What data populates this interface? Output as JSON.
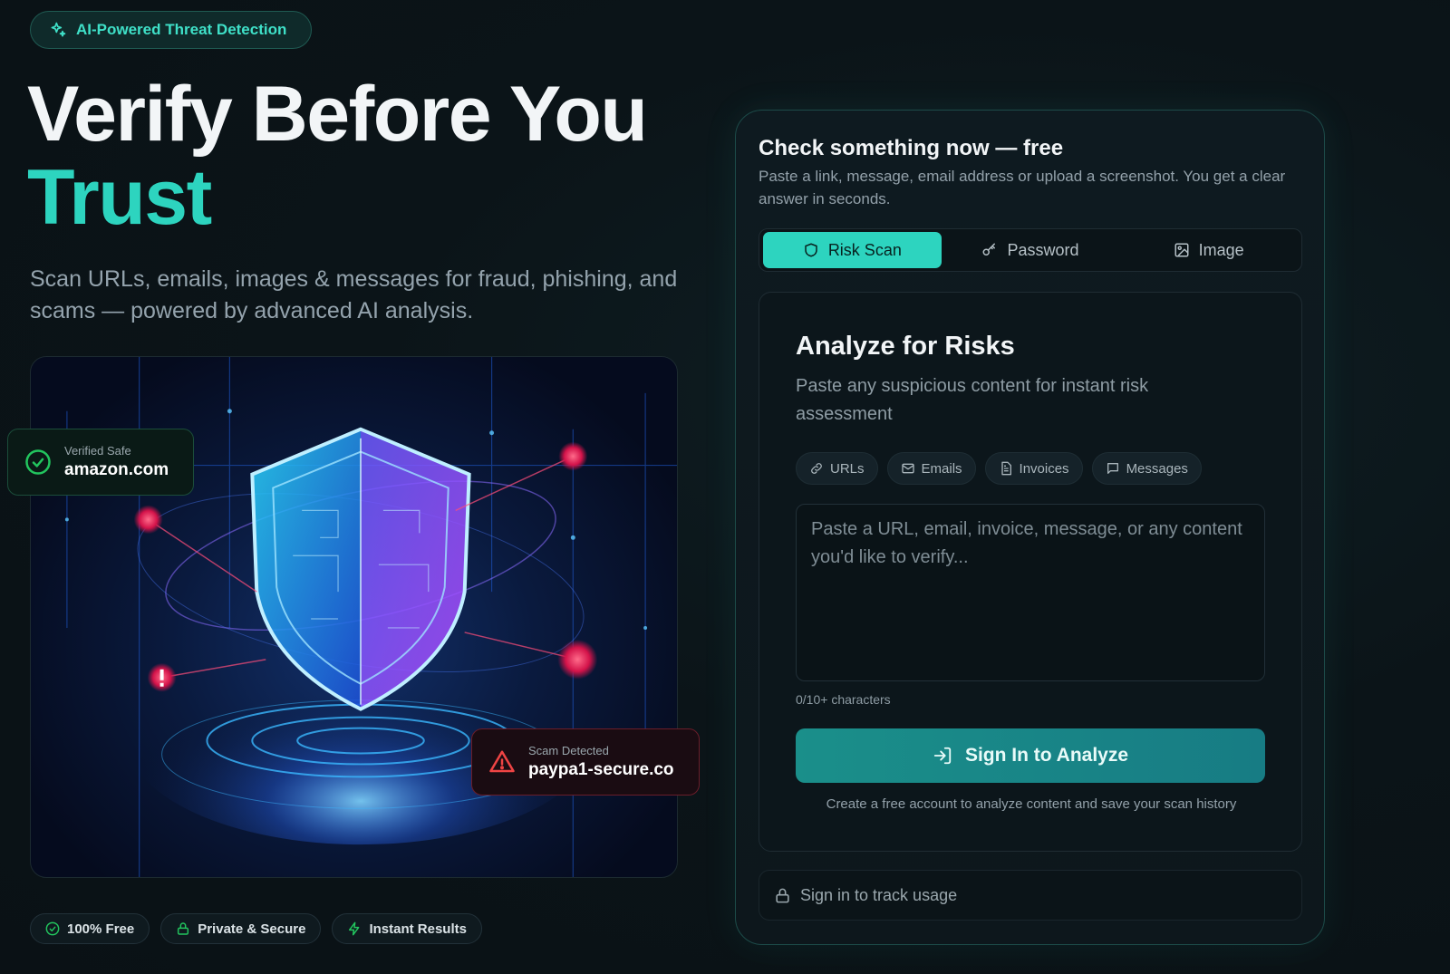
{
  "badge": {
    "label": "AI-Powered Threat Detection",
    "icon": "sparkles-icon"
  },
  "hero": {
    "title_line1": "Verify Before You",
    "title_line2": "Trust",
    "subtitle": "Scan URLs, emails, images & messages for fraud, phishing, and scams — powered by advanced AI analysis."
  },
  "illustration": {
    "safe_card": {
      "label": "Verified Safe",
      "value": "amazon.com",
      "icon": "check-circle-icon"
    },
    "scam_card": {
      "label": "Scam Detected",
      "value": "paypa1-secure.co",
      "icon": "warning-triangle-icon"
    }
  },
  "trust_pills": [
    {
      "label": "100% Free",
      "icon": "check-circle-icon"
    },
    {
      "label": "Private & Secure",
      "icon": "lock-icon"
    },
    {
      "label": "Instant Results",
      "icon": "lightning-icon"
    }
  ],
  "panel": {
    "title": "Check something now — free",
    "description": "Paste a link, message, email address or upload a screenshot. You get a clear answer in seconds.",
    "tabs": [
      {
        "label": "Risk Scan",
        "icon": "shield-icon",
        "active": true
      },
      {
        "label": "Password",
        "icon": "key-icon",
        "active": false
      },
      {
        "label": "Image",
        "icon": "image-icon",
        "active": false
      }
    ],
    "analyze": {
      "title": "Analyze for Risks",
      "description": "Paste any suspicious content for instant risk assessment",
      "chips": [
        {
          "label": "URLs",
          "icon": "link-icon"
        },
        {
          "label": "Emails",
          "icon": "mail-icon"
        },
        {
          "label": "Invoices",
          "icon": "document-icon"
        },
        {
          "label": "Messages",
          "icon": "message-icon"
        }
      ],
      "input_value": "",
      "input_placeholder": "Paste a URL, email, invoice, message, or any content you'd like to verify...",
      "char_count": "0/10+ characters",
      "cta_label": "Sign In to Analyze",
      "cta_note": "Create a free account to analyze content and save your scan history"
    },
    "usage_label": "Sign in to track usage"
  },
  "colors": {
    "accent": "#2dd4bf",
    "background": "#0b1418",
    "safe": "#22c55e",
    "danger": "#ef4444"
  }
}
